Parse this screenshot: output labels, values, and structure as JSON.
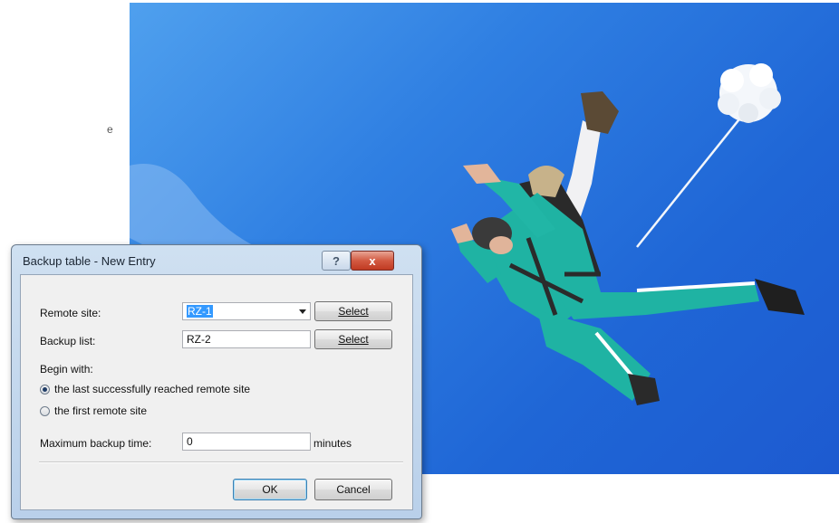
{
  "background": {
    "stray_text": "e",
    "photo_description": "tandem skydivers with drogue parachute against blue sky"
  },
  "dialog": {
    "title": "Backup table - New Entry",
    "help_label": "?",
    "close_label": "x",
    "remote_site": {
      "label": "Remote site:",
      "value": "RZ-1",
      "select_label": "Select"
    },
    "backup_list": {
      "label": "Backup list:",
      "value": "RZ-2",
      "select_label": "Select"
    },
    "begin_with": {
      "label": "Begin with:",
      "options": [
        {
          "label": "the last successfully reached remote site",
          "checked": true
        },
        {
          "label": "the first remote site",
          "checked": false
        }
      ]
    },
    "max_backup_time": {
      "label": "Maximum backup time:",
      "value": "0",
      "unit": "minutes"
    },
    "ok_label": "OK",
    "cancel_label": "Cancel"
  },
  "colors": {
    "sky_top": "#4fa0ee",
    "sky_bottom": "#1d5ad0",
    "suit": "#1fb3a3",
    "selection": "#3399ff",
    "close_button": "#c03a22"
  }
}
